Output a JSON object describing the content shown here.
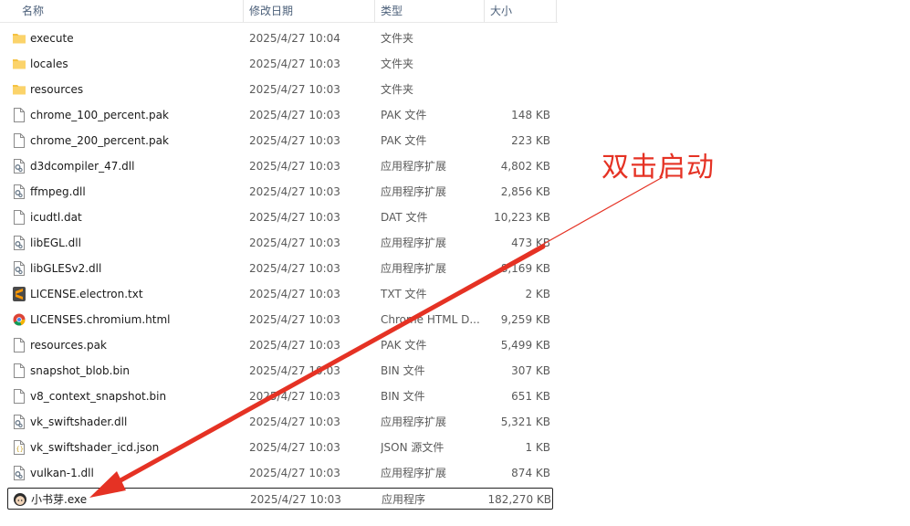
{
  "columns": {
    "name": "名称",
    "modified": "修改日期",
    "type": "类型",
    "size": "大小"
  },
  "files": [
    {
      "name": "execute",
      "date": "2025/4/27 10:04",
      "type": "文件夹",
      "size": "",
      "icon": "folder-icon"
    },
    {
      "name": "locales",
      "date": "2025/4/27 10:03",
      "type": "文件夹",
      "size": "",
      "icon": "folder-icon"
    },
    {
      "name": "resources",
      "date": "2025/4/27 10:03",
      "type": "文件夹",
      "size": "",
      "icon": "folder-icon"
    },
    {
      "name": "chrome_100_percent.pak",
      "date": "2025/4/27 10:03",
      "type": "PAK 文件",
      "size": "148 KB",
      "icon": "file-icon"
    },
    {
      "name": "chrome_200_percent.pak",
      "date": "2025/4/27 10:03",
      "type": "PAK 文件",
      "size": "223 KB",
      "icon": "file-icon"
    },
    {
      "name": "d3dcompiler_47.dll",
      "date": "2025/4/27 10:03",
      "type": "应用程序扩展",
      "size": "4,802 KB",
      "icon": "dll-icon"
    },
    {
      "name": "ffmpeg.dll",
      "date": "2025/4/27 10:03",
      "type": "应用程序扩展",
      "size": "2,856 KB",
      "icon": "dll-icon"
    },
    {
      "name": "icudtl.dat",
      "date": "2025/4/27 10:03",
      "type": "DAT 文件",
      "size": "10,223 KB",
      "icon": "file-icon"
    },
    {
      "name": "libEGL.dll",
      "date": "2025/4/27 10:03",
      "type": "应用程序扩展",
      "size": "473 KB",
      "icon": "dll-icon"
    },
    {
      "name": "libGLESv2.dll",
      "date": "2025/4/27 10:03",
      "type": "应用程序扩展",
      "size": "8,169 KB",
      "icon": "dll-icon"
    },
    {
      "name": "LICENSE.electron.txt",
      "date": "2025/4/27 10:03",
      "type": "TXT 文件",
      "size": "2 KB",
      "icon": "sublime-text-icon"
    },
    {
      "name": "LICENSES.chromium.html",
      "date": "2025/4/27 10:03",
      "type": "Chrome HTML D...",
      "size": "9,259 KB",
      "icon": "chrome-icon"
    },
    {
      "name": "resources.pak",
      "date": "2025/4/27 10:03",
      "type": "PAK 文件",
      "size": "5,499 KB",
      "icon": "file-icon"
    },
    {
      "name": "snapshot_blob.bin",
      "date": "2025/4/27 10:03",
      "type": "BIN 文件",
      "size": "307 KB",
      "icon": "file-icon"
    },
    {
      "name": "v8_context_snapshot.bin",
      "date": "2025/4/27 10:03",
      "type": "BIN 文件",
      "size": "651 KB",
      "icon": "file-icon"
    },
    {
      "name": "vk_swiftshader.dll",
      "date": "2025/4/27 10:03",
      "type": "应用程序扩展",
      "size": "5,321 KB",
      "icon": "dll-icon"
    },
    {
      "name": "vk_swiftshader_icd.json",
      "date": "2025/4/27 10:03",
      "type": "JSON 源文件",
      "size": "1 KB",
      "icon": "json-icon"
    },
    {
      "name": "vulkan-1.dll",
      "date": "2025/4/27 10:03",
      "type": "应用程序扩展",
      "size": "874 KB",
      "icon": "dll-icon"
    },
    {
      "name": "小书芽.exe",
      "date": "2025/4/27 10:03",
      "type": "应用程序",
      "size": "182,270 KB",
      "icon": "app-avatar-icon",
      "selected": true
    }
  ],
  "annotation": {
    "text": "双击启动",
    "color": "#e53224"
  },
  "colors": {
    "folder": "#f5c242",
    "header_text": "#4c607a"
  }
}
